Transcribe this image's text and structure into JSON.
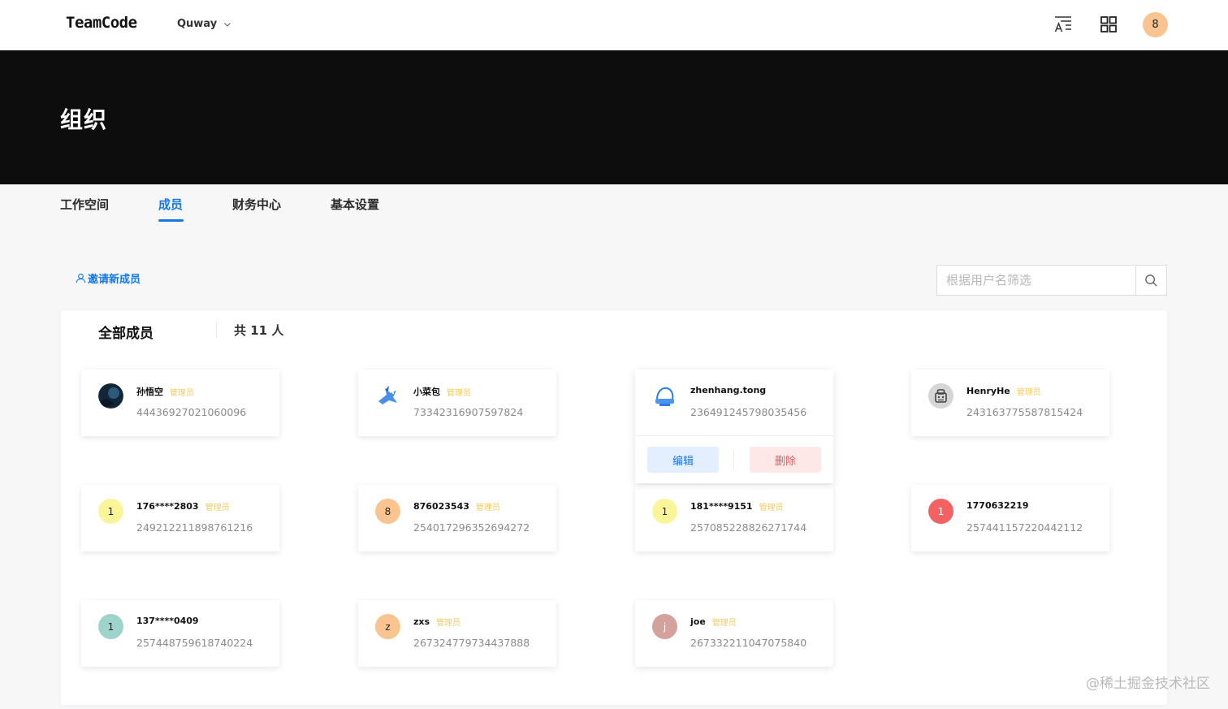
{
  "header": {
    "logo": "TeamCode",
    "org_name": "Quway",
    "avatar_letter": "8",
    "avatar_color": "#f9c48f"
  },
  "banner": {
    "title": "组织"
  },
  "tabs": [
    {
      "label": "工作空间",
      "active": false
    },
    {
      "label": "成员",
      "active": true
    },
    {
      "label": "财务中心",
      "active": false
    },
    {
      "label": "基本设置",
      "active": false
    }
  ],
  "toolbar": {
    "invite_label": "邀请新成员",
    "search_placeholder": "根据用户名筛选"
  },
  "panel": {
    "title": "全部成员",
    "count": "共 11 人"
  },
  "members": [
    {
      "name": "孙悟空",
      "role": "管理员",
      "uid": "44436927021060096",
      "avatar": "dark-photo"
    },
    {
      "name": "小菜包",
      "role": "管理员",
      "uid": "73342316907597824",
      "avatar": "bird-icon"
    },
    {
      "name": "zhenhang.tong",
      "role": "",
      "uid": "236491245798035456",
      "avatar": "blue-helmet-icon",
      "actions": {
        "edit": "编辑",
        "delete": "删除"
      }
    },
    {
      "name": "HenryHe",
      "role": "管理员",
      "uid": "243163775587815424",
      "avatar": "robot-icon"
    },
    {
      "name": "176****2803",
      "role": "管理员",
      "uid": "249212211898761216",
      "avatar_letter": "1",
      "avatar_color": "#fbf59a"
    },
    {
      "name": "876023543",
      "role": "管理员",
      "uid": "254017296352694272",
      "avatar_letter": "8",
      "avatar_color": "#f9c48f"
    },
    {
      "name": "181****9151",
      "role": "管理员",
      "uid": "257085228826271744",
      "avatar_letter": "1",
      "avatar_color": "#fbf59a"
    },
    {
      "name": "1770632219",
      "role": "",
      "uid": "257441157220442112",
      "avatar_letter": "1",
      "avatar_color": "#f26262"
    },
    {
      "name": "137****0409",
      "role": "",
      "uid": "257448759618740224",
      "avatar_letter": "1",
      "avatar_color": "#9ed3cc"
    },
    {
      "name": "zxs",
      "role": "管理员",
      "uid": "267324779734437888",
      "avatar_letter": "z",
      "avatar_color": "#f9c48f"
    },
    {
      "name": "joe",
      "role": "管理员",
      "uid": "267332211047075840",
      "avatar_letter": "j",
      "avatar_color": "#d4a19c"
    }
  ],
  "watermark": "@稀土掘金技术社区"
}
